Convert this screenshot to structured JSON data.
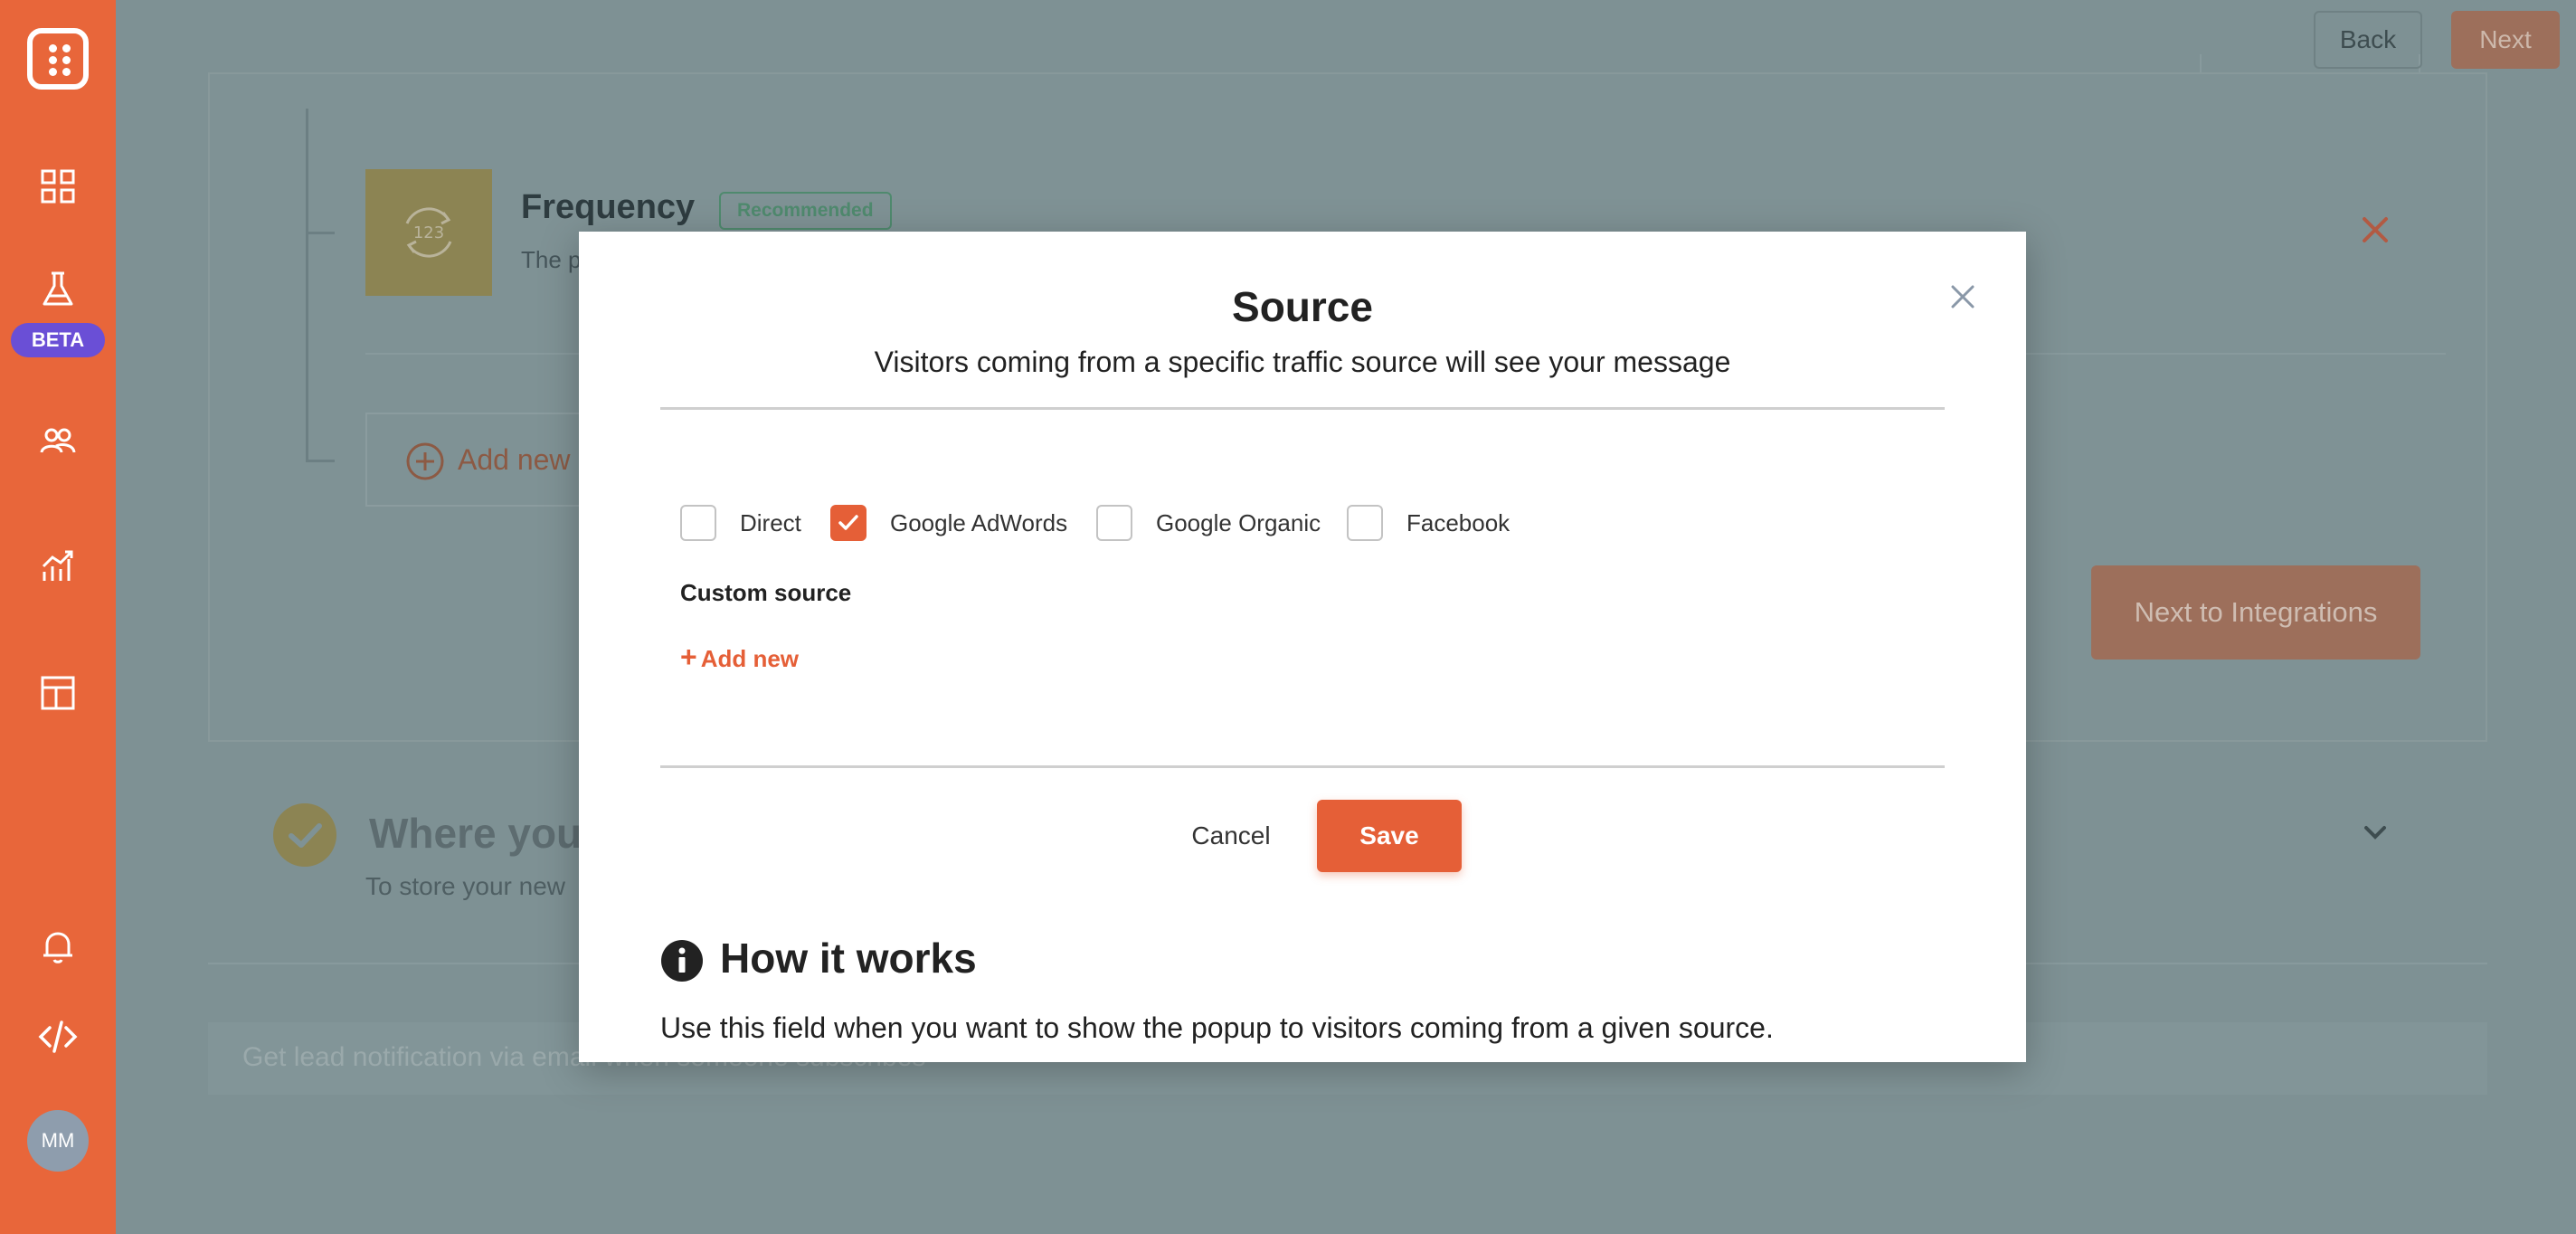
{
  "sidebar": {
    "beta_label": "BETA",
    "avatar_initials": "MM",
    "icons": [
      "logo-icon",
      "dashboard-icon",
      "flask-icon",
      "users-icon",
      "analytics-icon",
      "layout-icon",
      "bell-icon",
      "code-icon"
    ]
  },
  "header": {
    "back_label": "Back",
    "next_label": "Next"
  },
  "background": {
    "frequency_title": "Frequency",
    "recommended_badge": "Recommended",
    "frequency_desc": "The p",
    "add_new_label": "Add new",
    "next_to_integrations": "Next to Integrations",
    "where_title": "Where you",
    "where_desc": "To store your new",
    "notification_text": "Get lead notification via email when someone subscribes"
  },
  "modal": {
    "title": "Source",
    "subtitle": "Visitors coming from a specific traffic source will see your message",
    "options": [
      {
        "label": "Direct",
        "checked": false
      },
      {
        "label": "Google AdWords",
        "checked": true
      },
      {
        "label": "Google Organic",
        "checked": false
      },
      {
        "label": "Facebook",
        "checked": false
      }
    ],
    "custom_source_label": "Custom source",
    "add_new_plus": "+",
    "add_new_label": "Add new",
    "cancel_label": "Cancel",
    "save_label": "Save",
    "how_title": "How it works",
    "how_desc": "Use this field when you want to show the popup to visitors coming from a given source."
  },
  "colors": {
    "accent": "#e55f37",
    "sidebar": "#e8663a",
    "beta": "#6a4fd6"
  }
}
